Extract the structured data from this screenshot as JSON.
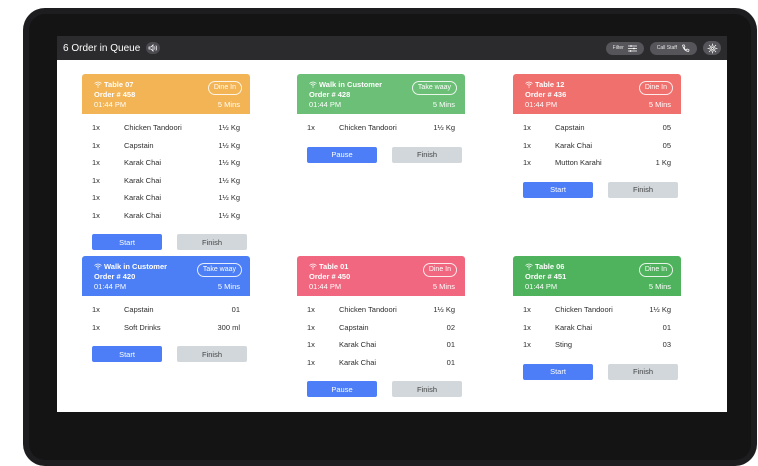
{
  "topbar": {
    "queue_title": "6 Order in Queue",
    "filter_label": "Filter",
    "call_staff_label": "Call Staff"
  },
  "colors": {
    "orange": "#f2b455",
    "green": "#6bbf76",
    "red": "#f0706d",
    "blue": "#4c7ef5",
    "pink": "#f1677f",
    "green2": "#4fb25c"
  },
  "orders": [
    {
      "title": "Table 07",
      "order": "Order # 458",
      "time": "01:44 PM",
      "badge": "Dine In",
      "mins": "5 Mins",
      "color_key": "orange",
      "items": [
        {
          "qty": "1x",
          "name": "Chicken Tandoori",
          "amount": "1½ Kg"
        },
        {
          "qty": "1x",
          "name": "Capstain",
          "amount": "1½ Kg"
        },
        {
          "qty": "1x",
          "name": "Karak Chai",
          "amount": "1½ Kg"
        },
        {
          "qty": "1x",
          "name": "Karak Chai",
          "amount": "1½ Kg"
        },
        {
          "qty": "1x",
          "name": "Karak Chai",
          "amount": "1½ Kg"
        },
        {
          "qty": "1x",
          "name": "Karak Chai",
          "amount": "1½ Kg"
        }
      ],
      "primary_label": "Start",
      "finish_label": "Finish"
    },
    {
      "title": "Walk in Customer",
      "order": "Order # 428",
      "time": "01:44 PM",
      "badge": "Take waay",
      "mins": "5 Mins",
      "color_key": "green",
      "items": [
        {
          "qty": "1x",
          "name": "Chicken Tandoori",
          "amount": "1½ Kg"
        }
      ],
      "primary_label": "Pause",
      "finish_label": "Finish"
    },
    {
      "title": "Table 12",
      "order": "Order # 436",
      "time": "01:44 PM",
      "badge": "Dine In",
      "mins": "5 Mins",
      "color_key": "red",
      "items": [
        {
          "qty": "1x",
          "name": "Capstain",
          "amount": "05"
        },
        {
          "qty": "1x",
          "name": "Karak Chai",
          "amount": "05"
        },
        {
          "qty": "1x",
          "name": "Mutton Karahi",
          "amount": "1 Kg"
        }
      ],
      "primary_label": "Start",
      "finish_label": "Finish"
    },
    {
      "title": "Walk in Customer",
      "order": "Order # 420",
      "time": "01:44 PM",
      "badge": "Take waay",
      "mins": "5 Mins",
      "color_key": "blue",
      "items": [
        {
          "qty": "1x",
          "name": "Capstain",
          "amount": "01"
        },
        {
          "qty": "1x",
          "name": "Soft Drinks",
          "amount": "300 ml"
        }
      ],
      "primary_label": "Start",
      "finish_label": "Finish"
    },
    {
      "title": "Table 01",
      "order": "Order # 450",
      "time": "01:44 PM",
      "badge": "Dine In",
      "mins": "5 Mins",
      "color_key": "pink",
      "items": [
        {
          "qty": "1x",
          "name": "Chicken Tandoori",
          "amount": "1½ Kg"
        },
        {
          "qty": "1x",
          "name": "Capstain",
          "amount": "02"
        },
        {
          "qty": "1x",
          "name": "Karak Chai",
          "amount": "01"
        },
        {
          "qty": "1x",
          "name": "Karak Chai",
          "amount": "01"
        }
      ],
      "primary_label": "Pause",
      "finish_label": "Finish"
    },
    {
      "title": "Table 06",
      "order": "Order # 451",
      "time": "01:44 PM",
      "badge": "Dine In",
      "mins": "5 Mins",
      "color_key": "green2",
      "items": [
        {
          "qty": "1x",
          "name": "Chicken Tandoori",
          "amount": "1½ Kg"
        },
        {
          "qty": "1x",
          "name": "Karak Chai",
          "amount": "01"
        },
        {
          "qty": "1x",
          "name": "Sting",
          "amount": "03"
        }
      ],
      "primary_label": "Start",
      "finish_label": "Finish"
    }
  ]
}
